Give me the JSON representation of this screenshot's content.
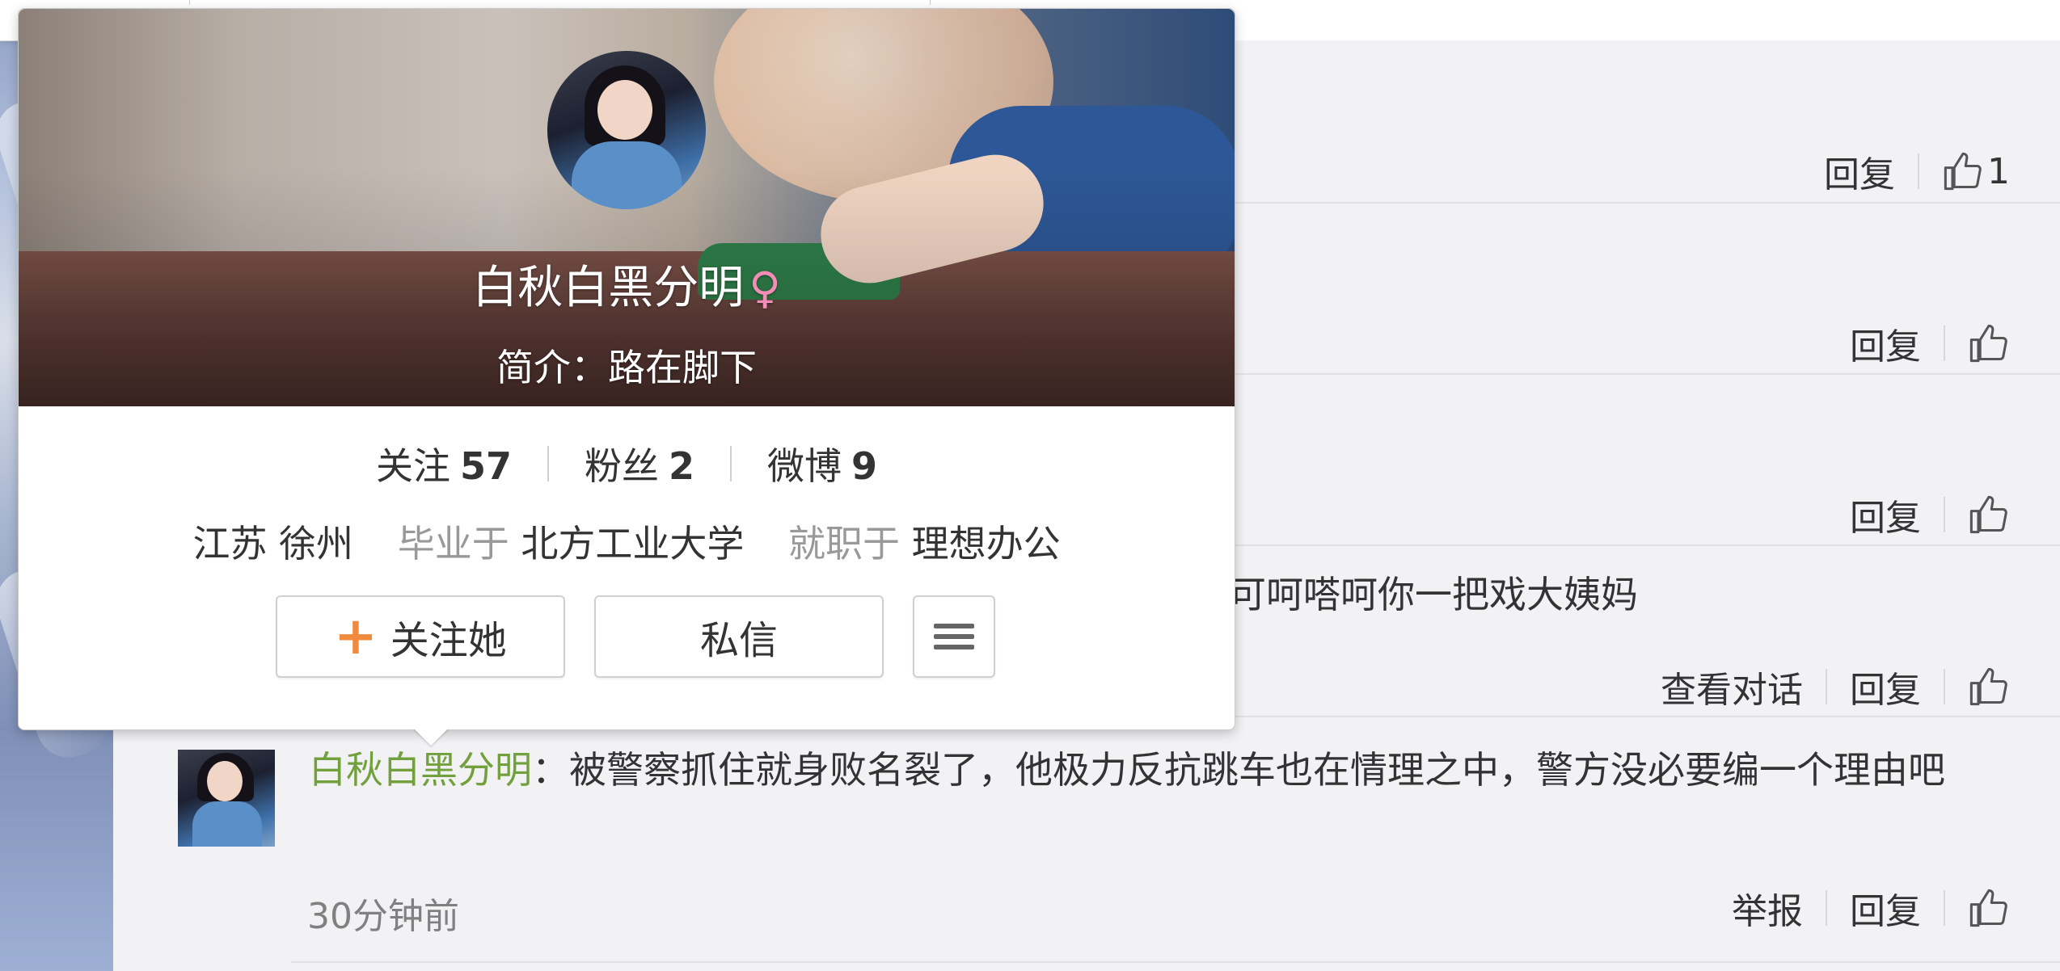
{
  "comments": {
    "rows": [
      {
        "actions": [
          "回复"
        ],
        "like_count": "1"
      },
      {
        "actions": [
          "回复"
        ],
        "like_count": ""
      },
      {
        "actions": [
          "回复"
        ],
        "like_count": ""
      },
      {
        "partial_text": "可呵嗒呵你一把戏大姨妈",
        "actions": [
          "查看对话",
          "回复"
        ],
        "like_count": ""
      }
    ],
    "last": {
      "username": "白秋白黑分明",
      "colon": "：",
      "text": "被警察抓住就身败名裂了，他极力反抗跳车也在情理之中，警方没必要编一个理由吧",
      "time": "30分钟前",
      "report_label": "举报",
      "reply_label": "回复"
    }
  },
  "user_card": {
    "name": "白秋白黑分明",
    "gender_symbol": "♀",
    "bio": "简介：路在脚下",
    "stats": [
      {
        "label": "关注",
        "value": "57"
      },
      {
        "label": "粉丝",
        "value": "2"
      },
      {
        "label": "微博",
        "value": "9"
      }
    ],
    "location": "江苏 徐州",
    "edu_label": "毕业于",
    "edu_value": "北方工业大学",
    "job_label": "就职于",
    "job_value": "理想办公",
    "follow_label": "关注她",
    "message_label": "私信"
  },
  "icons": {
    "like": "thumbs-up-icon",
    "menu": "menu-icon",
    "plus": "plus-icon"
  },
  "colors": {
    "username_green": "#72a03c",
    "follow_plus_orange": "#f08a3c",
    "gender_pink": "#f38db7"
  }
}
